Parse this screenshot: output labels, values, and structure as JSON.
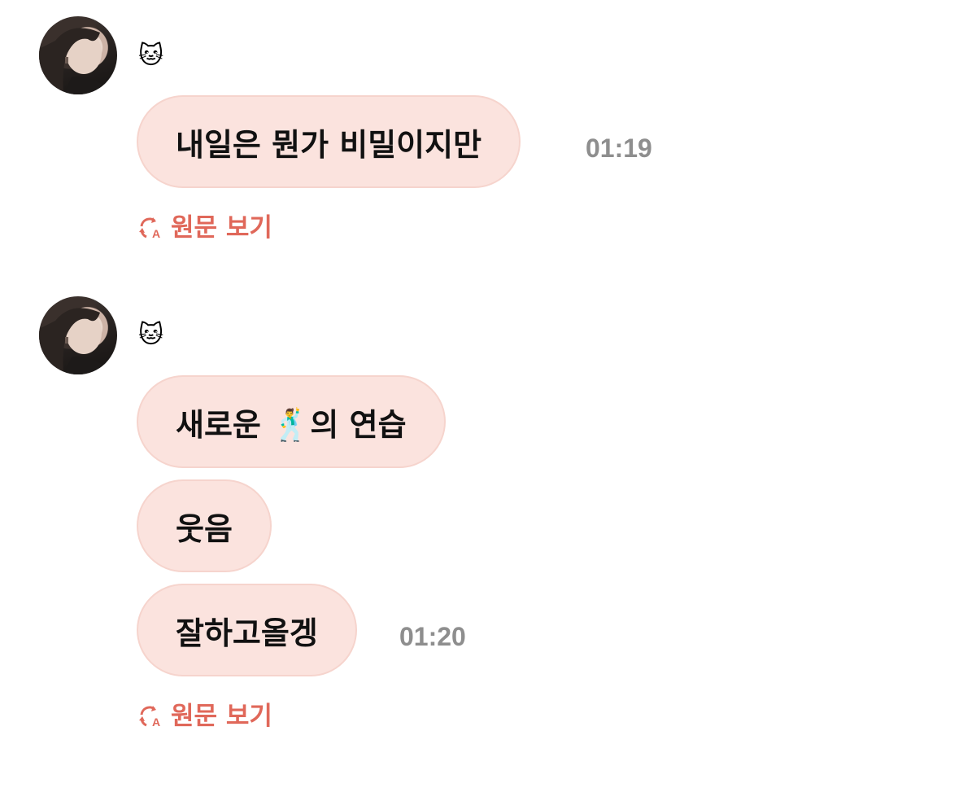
{
  "groups": [
    {
      "sender": {
        "name_emoji": "🐱",
        "avatar_icon": "profile-photo"
      },
      "messages": [
        {
          "text": "내일은 뭔가 비밀이지만",
          "time": "01:19"
        }
      ],
      "view_original_label": "원문 보기"
    },
    {
      "sender": {
        "name_emoji": "🐱",
        "avatar_icon": "profile-photo"
      },
      "messages": [
        {
          "text": "새로운 🕺의 연습",
          "time": ""
        },
        {
          "text": "웃음",
          "time": ""
        },
        {
          "text": "잘하고올겡",
          "time": "01:20"
        }
      ],
      "view_original_label": "원문 보기"
    }
  ],
  "colors": {
    "bubble_bg": "#fbe3de",
    "bubble_border": "#f6d4cd",
    "link": "#e0685a",
    "timestamp": "#8e8e8e"
  }
}
